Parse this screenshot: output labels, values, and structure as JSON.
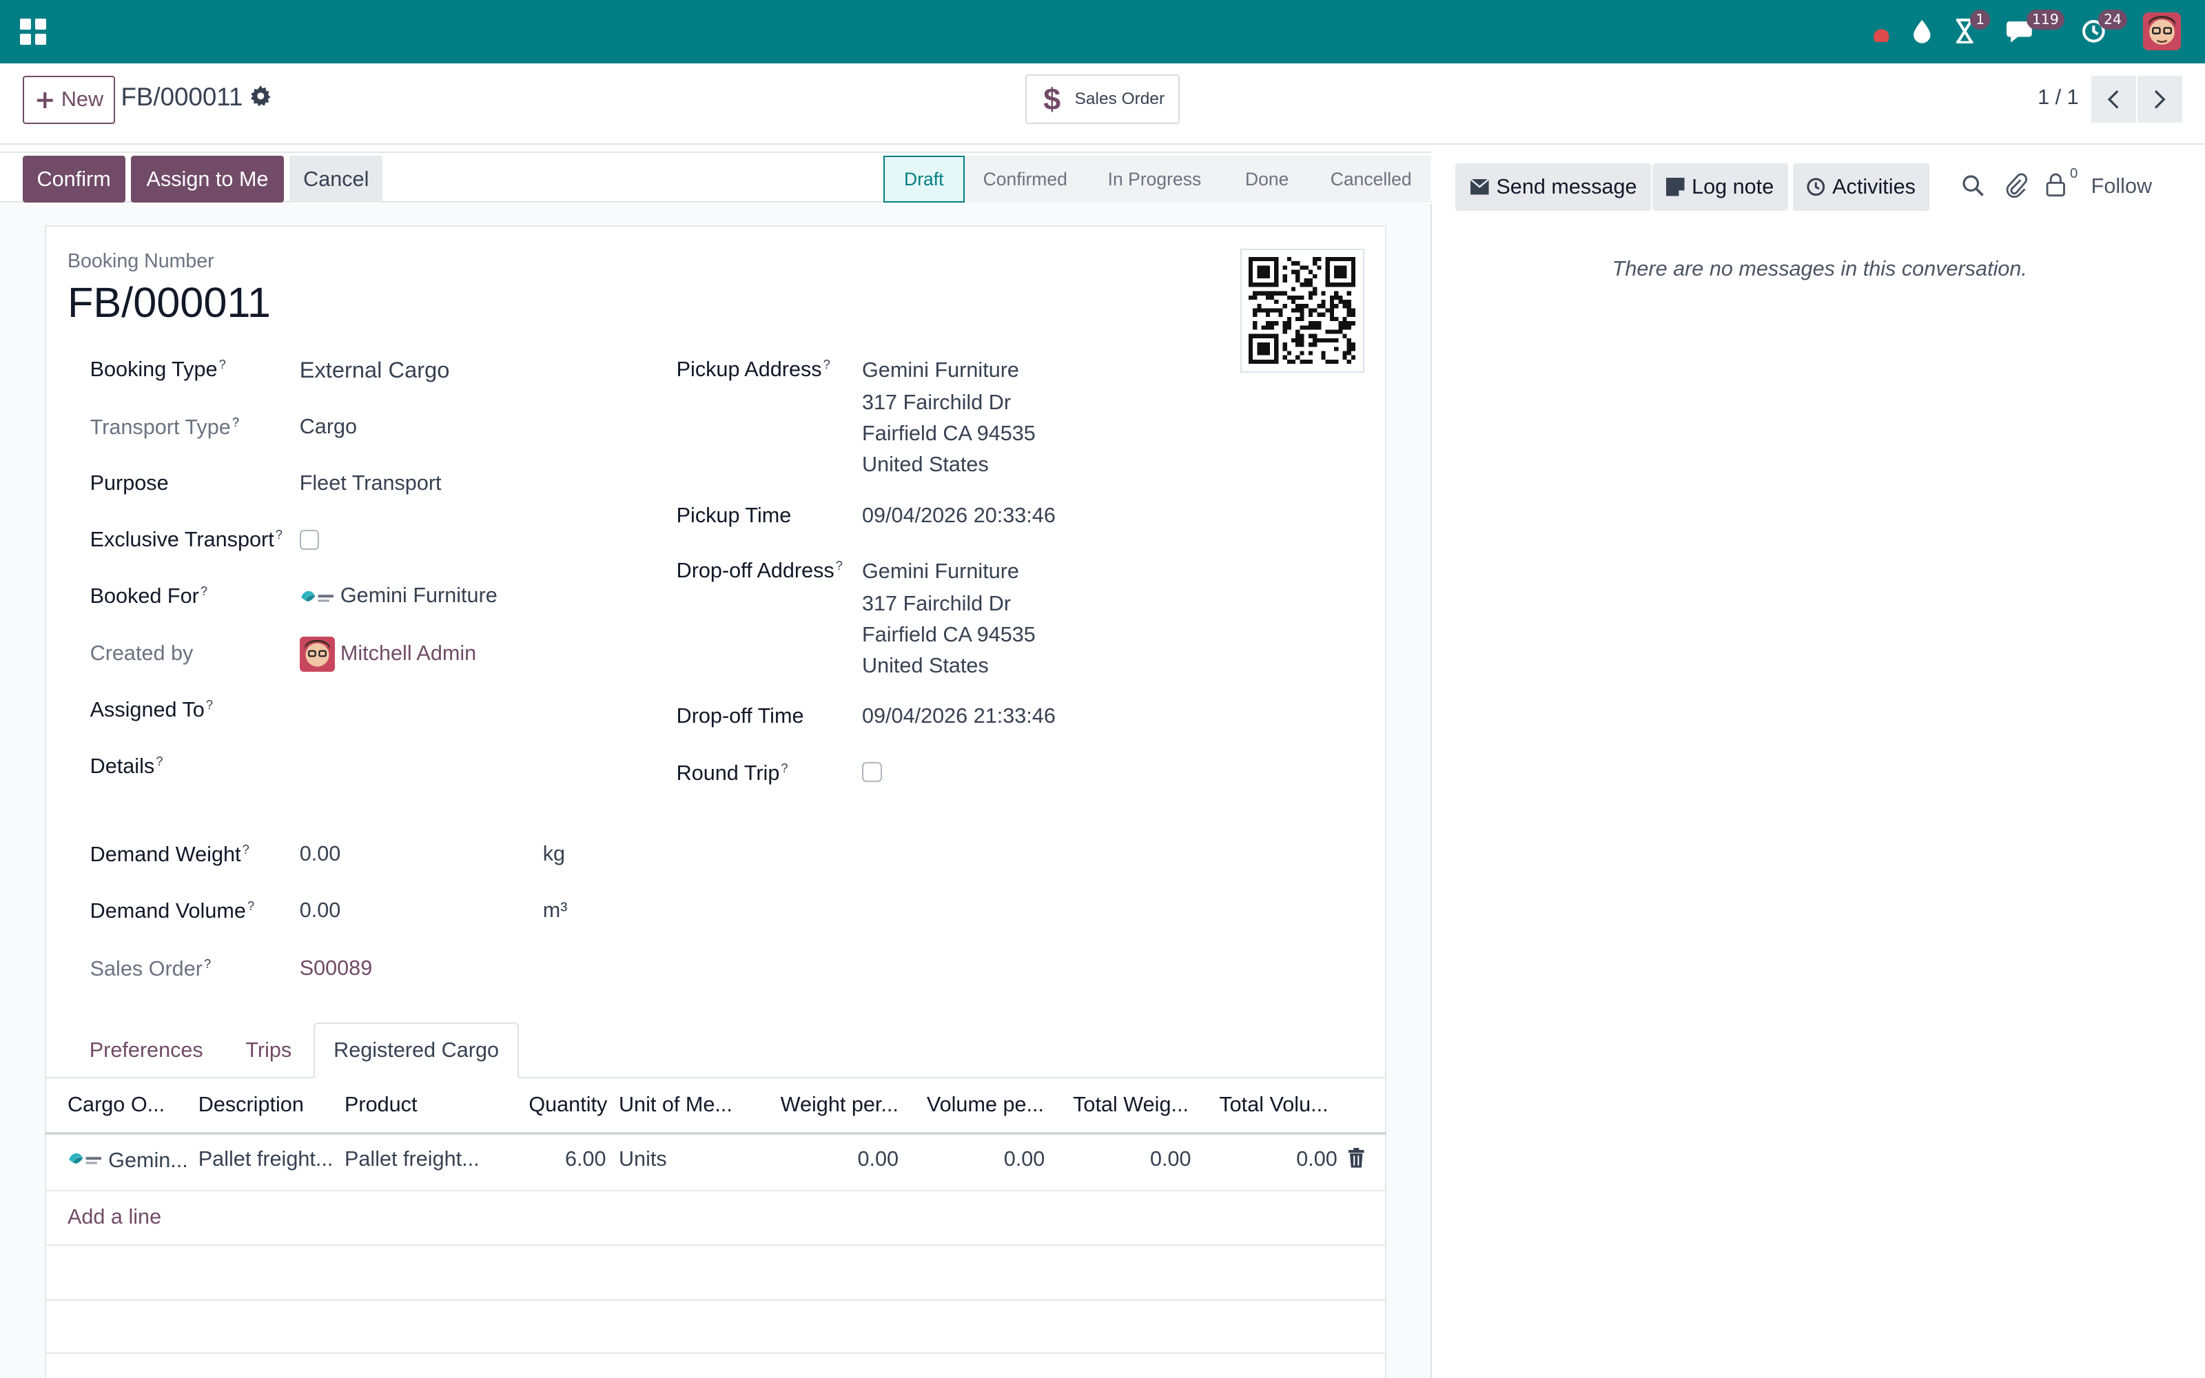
{
  "navbar": {
    "badges": {
      "activity": "1",
      "messages": "119",
      "clock": "24"
    }
  },
  "control": {
    "new_label": "New",
    "breadcrumb": "FB/000011",
    "smart_button": "Sales Order",
    "pager": "1 / 1"
  },
  "actions": {
    "confirm": "Confirm",
    "assign": "Assign to Me",
    "cancel": "Cancel"
  },
  "stages": [
    "Draft",
    "Confirmed",
    "In Progress",
    "Done",
    "Cancelled"
  ],
  "form": {
    "booking_number_label": "Booking Number",
    "booking_number": "FB/000011",
    "left": {
      "booking_type_label": "Booking Type",
      "booking_type": "External Cargo",
      "transport_type_label": "Transport Type",
      "transport_type": "Cargo",
      "purpose_label": "Purpose",
      "purpose": "Fleet Transport",
      "exclusive_label": "Exclusive Transport",
      "booked_for_label": "Booked For",
      "booked_for": "Gemini Furniture",
      "created_by_label": "Created by",
      "created_by": "Mitchell Admin",
      "assigned_to_label": "Assigned To",
      "details_label": "Details",
      "demand_weight_label": "Demand Weight",
      "demand_weight": "0.00",
      "weight_unit": "kg",
      "demand_volume_label": "Demand Volume",
      "demand_volume": "0.00",
      "volume_unit": "m³",
      "sales_order_label": "Sales Order",
      "sales_order": "S00089"
    },
    "right": {
      "pickup_address_label": "Pickup Address",
      "pickup_address": [
        "Gemini Furniture",
        "317 Fairchild Dr",
        "Fairfield CA 94535",
        "United States"
      ],
      "pickup_time_label": "Pickup Time",
      "pickup_time": "09/04/2026 20:33:46",
      "dropoff_address_label": "Drop-off Address",
      "dropoff_address": [
        "Gemini Furniture",
        "317 Fairchild Dr",
        "Fairfield CA 94535",
        "United States"
      ],
      "dropoff_time_label": "Drop-off Time",
      "dropoff_time": "09/04/2026 21:33:46",
      "round_trip_label": "Round Trip"
    }
  },
  "tabs": [
    "Preferences",
    "Trips",
    "Registered Cargo"
  ],
  "cargo_table": {
    "headers": [
      "Cargo O...",
      "Description",
      "Product",
      "Quantity",
      "Unit of Me...",
      "Weight per...",
      "Volume pe...",
      "Total Weig...",
      "Total Volu..."
    ],
    "rows": [
      [
        "Gemin...",
        "Pallet freight...",
        "Pallet freight...",
        "6.00",
        "Units",
        "0.00",
        "0.00",
        "0.00",
        "0.00"
      ]
    ],
    "add_line": "Add a line"
  },
  "chatter": {
    "send_message": "Send message",
    "log_note": "Log note",
    "activities": "Activities",
    "followers_count": "0",
    "follow": "Follow",
    "empty": "There are no messages in this conversation."
  },
  "colors": {
    "navbar": "#017e84",
    "primary": "#714b67",
    "stage_active": "#017e84"
  }
}
